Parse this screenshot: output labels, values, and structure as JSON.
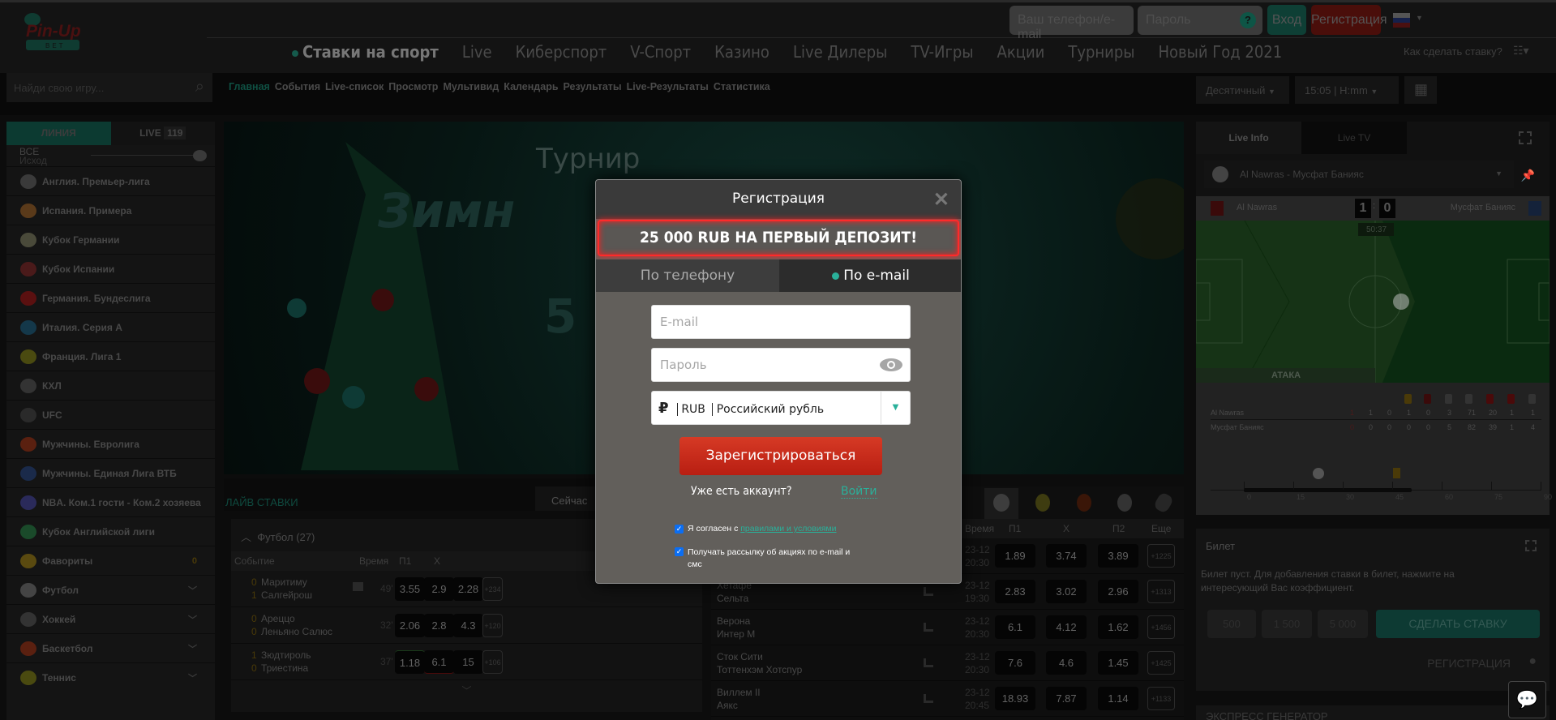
{
  "header": {
    "logo_text": "Pin-Up BET",
    "phone_placeholder": "Ваш телефон/e-mail",
    "password_placeholder": "Пароль",
    "help": "?",
    "login": "Вход",
    "register": "Регистрация",
    "nav": [
      "Ставки на спорт",
      "Live",
      "Киберспорт",
      "V-Спорт",
      "Казино",
      "Live Дилеры",
      "TV-Игры",
      "Акции",
      "Турниры",
      "Новый Год 2021"
    ],
    "how_to_bet": "Как сделать ставку?"
  },
  "toolbar": {
    "search_placeholder": "Найди свою игру...",
    "breadcrumbs": [
      "Главная",
      "События",
      "Live-список",
      "Просмотр",
      "Мультивид",
      "Календарь",
      "Результаты",
      "Live-Результаты",
      "Статистика"
    ],
    "odds_format": "Десятичный",
    "time_format": "15:05 | H:mm"
  },
  "sidebar": {
    "tab_line": "ЛИНИЯ",
    "tab_live": "LIVE",
    "live_count": "119",
    "all": "ВСЕ",
    "outcome": "Исход",
    "items": [
      {
        "label": "Англия. Премьер-лига",
        "color": "#3a3a3a"
      },
      {
        "label": "Испания. Примера",
        "color": "#5a3a1a"
      },
      {
        "label": "Кубок Германии",
        "color": "#4a4a3a"
      },
      {
        "label": "Кубок Испании",
        "color": "#4a1a1a"
      },
      {
        "label": "Германия. Бундеслига",
        "color": "#5a1010"
      },
      {
        "label": "Италия. Серия А",
        "color": "#14384a"
      },
      {
        "label": "Франция. Лига 1",
        "color": "#4a4a10"
      },
      {
        "label": "КХЛ",
        "color": "#333333"
      },
      {
        "label": "UFC",
        "color": "#2a2a2a"
      },
      {
        "label": "Мужчины. Евролига",
        "color": "#5a2010"
      },
      {
        "label": "Мужчины. Единая Лига ВТБ",
        "color": "#1a2a4a"
      },
      {
        "label": "NBA. Ком.1 гости - Ком.2 хозяева",
        "color": "#2a2a5a"
      },
      {
        "label": "Кубок Английской лиги",
        "color": "#1a4a2a"
      },
      {
        "label": "Фавориты",
        "color": "#5a4a10",
        "count": "0"
      },
      {
        "label": "Футбол",
        "color": "#444444",
        "chevron": true
      },
      {
        "label": "Хоккей",
        "color": "#333333",
        "chevron": true
      },
      {
        "label": "Баскетбол",
        "color": "#5a2010",
        "chevron": true
      },
      {
        "label": "Теннис",
        "color": "#4a4a10",
        "chevron": true
      }
    ]
  },
  "banner": {
    "title": "Турнир"
  },
  "live_bets": {
    "title": "ЛАЙВ СТАВКИ",
    "tab_now": "Сейчас",
    "group": "Футбол",
    "group_count": "(27)",
    "columns": [
      "Событие",
      "Время",
      "П1",
      "X",
      "П2"
    ],
    "rows": [
      {
        "s1": "0",
        "t1": "Маритиму",
        "s2": "1",
        "t2": "Салгейрош",
        "time": "49'",
        "p1": "3.55",
        "x": "2.9",
        "p2": "2.28",
        "more": "+234"
      },
      {
        "s1": "0",
        "t1": "Ареццо",
        "s2": "0",
        "t2": "Леньяно Салюс",
        "time": "32'",
        "p1": "2.06",
        "x": "2.8",
        "p2": "4.3",
        "more": "+120"
      },
      {
        "s1": "1",
        "t1": "Зюдтироль",
        "s2": "0",
        "t2": "Триестина",
        "time": "37'",
        "p1": "1.18",
        "x": "6.1",
        "p2": "15",
        "more": "+106"
      }
    ]
  },
  "upcoming": {
    "columns": [
      "Время",
      "П1",
      "X",
      "П2",
      "Еще"
    ],
    "rows": [
      {
        "t1": "",
        "t2": "",
        "date": "23-12",
        "time": "20:30",
        "p1": "1.89",
        "x": "3.74",
        "p2": "3.89",
        "more": "+1225"
      },
      {
        "t1": "Хетафе",
        "t2": "Сельта",
        "date": "23-12",
        "time": "19:30",
        "p1": "2.83",
        "x": "3.02",
        "p2": "2.96",
        "more": "+1313"
      },
      {
        "t1": "Верона",
        "t2": "Интер М",
        "date": "23-12",
        "time": "20:30",
        "p1": "6.1",
        "x": "4.12",
        "p2": "1.62",
        "more": "+1456"
      },
      {
        "t1": "Сток Сити",
        "t2": "Тоттенхэм Хотспур",
        "date": "23-12",
        "time": "20:30",
        "p1": "7.6",
        "x": "4.6",
        "p2": "1.45",
        "more": "+1425"
      },
      {
        "t1": "Виллем II",
        "t2": "Аякс",
        "date": "23-12",
        "time": "20:45",
        "p1": "18.93",
        "x": "7.87",
        "p2": "1.14",
        "more": "+1133"
      }
    ]
  },
  "live_info": {
    "tab_info": "Live Info",
    "tab_tv": "Live TV",
    "match": "Al Nawras - Мусфат Банияс",
    "home": "Al Nawras",
    "away": "Мусфат Банияс",
    "score_home": "1",
    "score_away": "0",
    "clock": "50:37",
    "state": "АТАКА",
    "stats_home": [
      "1",
      "1",
      "0",
      "1",
      "0",
      "3",
      "71",
      "20",
      "1",
      "1"
    ],
    "stats_away": [
      "0",
      "0",
      "0",
      "0",
      "0",
      "5",
      "82",
      "39",
      "1",
      "4"
    ],
    "timeline_ticks": [
      "0",
      "15",
      "30",
      "45",
      "60",
      "75",
      "90"
    ],
    "timeline_progress_minute": 51
  },
  "ticket": {
    "title": "Билет",
    "empty": "Билет пуст. Для добавления ставки в билет, нажмите на интересующий Вас коэффициент.",
    "amounts": [
      "500",
      "1 500",
      "5 000"
    ],
    "bet": "СДЕЛАТЬ СТАВКУ",
    "register": "РЕГИСТРАЦИЯ",
    "express": "ЭКСПРЕСС ГЕНЕРАТОР"
  },
  "modal": {
    "title": "Регистрация",
    "promo": "25 000 RUB НА ПЕРВЫЙ ДЕПОЗИТ!",
    "tab_phone": "По телефону",
    "tab_email": "По e-mail",
    "email_placeholder": "E-mail",
    "password_placeholder": "Пароль",
    "currency_code": "RUB",
    "currency_name": "Российский рубль",
    "submit": "Зарегистрироваться",
    "have_account": "Уже есть аккаунт?",
    "login": "Войти",
    "agree_prefix": "Я согласен с ",
    "agree_link": "правилами и условиями",
    "newsletter": "Получать рассылку об акциях по e-mail и смс",
    "agree_checked": true,
    "newsletter_checked": true
  },
  "colors": {
    "accent": "#2ab09a",
    "danger": "#d63a25",
    "promo_border": "#ff2a2a",
    "modal_bg": "#625f5b"
  }
}
